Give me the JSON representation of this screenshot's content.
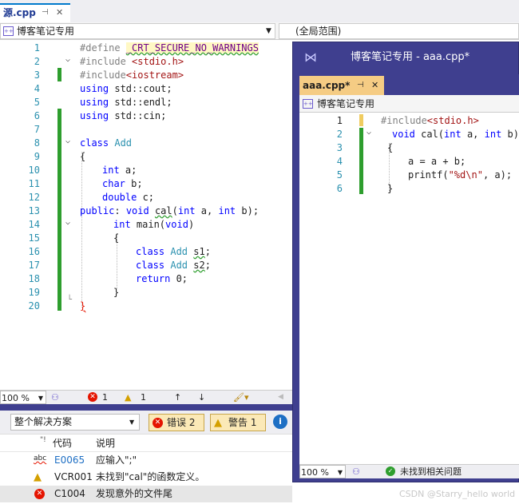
{
  "main_editor": {
    "tab_label": "源.cpp",
    "tab_pin": "⊣",
    "tab_close": "✕",
    "project_dropdown": "博客笔记专用",
    "scope_dropdown": "(全局范围)",
    "lines": [
      {
        "n": "1",
        "text": "#define _CRT_SECURE_NO_WARNINGS"
      },
      {
        "n": "2",
        "text": "#include <stdio.h>"
      },
      {
        "n": "3",
        "text": "#include<iostream>"
      },
      {
        "n": "4",
        "text": "using std::cout;"
      },
      {
        "n": "5",
        "text": "using std::endl;"
      },
      {
        "n": "6",
        "text": "using std::cin;"
      },
      {
        "n": "7",
        "text": ""
      },
      {
        "n": "8",
        "text": "class Add"
      },
      {
        "n": "9",
        "text": "{"
      },
      {
        "n": "10",
        "text": "int a;"
      },
      {
        "n": "11",
        "text": "char b;"
      },
      {
        "n": "12",
        "text": "double c;"
      },
      {
        "n": "13",
        "text": "public:  void cal(int a, int b);"
      },
      {
        "n": "14",
        "text": "int main(void)"
      },
      {
        "n": "15",
        "text": "{"
      },
      {
        "n": "16",
        "text": "class Add s1;"
      },
      {
        "n": "17",
        "text": "class Add s2;"
      },
      {
        "n": "18",
        "text": "return 0;"
      },
      {
        "n": "19",
        "text": "}"
      },
      {
        "n": "20",
        "text": "}"
      }
    ],
    "status": {
      "zoom": "100 %",
      "errors": "1",
      "warnings": "1",
      "up": "↑",
      "down": "↓"
    }
  },
  "floating_window": {
    "title": "博客笔记专用 - aaa.cpp*",
    "tab_label": "aaa.cpp*",
    "tab_pin": "⊣",
    "tab_close": "✕",
    "project_dropdown": "博客笔记专用",
    "lines": [
      {
        "n": "1",
        "text": "#include<stdio.h>"
      },
      {
        "n": "2",
        "text": "void cal(int a, int b)"
      },
      {
        "n": "3",
        "text": "{"
      },
      {
        "n": "4",
        "text": "a = a + b;"
      },
      {
        "n": "5",
        "text": "printf(\"%d\\n\", a);"
      },
      {
        "n": "6",
        "text": "}"
      }
    ],
    "status": {
      "zoom": "100 %",
      "message": "未找到相关问题"
    }
  },
  "error_list": {
    "scope": "整个解决方案",
    "errors_btn": "错误 2",
    "warnings_btn": "警告 1",
    "columns": [
      "代码",
      "说明"
    ],
    "rows": [
      {
        "code": "E0065",
        "desc": "应输入\";\"",
        "kind": "abc"
      },
      {
        "code": "VCR001",
        "desc": "未找到\"cal\"的函数定义。",
        "kind": "warning"
      },
      {
        "code": "C1004",
        "desc": "发现意外的文件尾",
        "kind": "error"
      }
    ]
  },
  "watermark": "CSDN @Starry_hello world",
  "colors": {
    "accent": "#007acc",
    "window_title": "#3f3f8f",
    "change_bar": "#2e9e2e",
    "error": "#e51400",
    "warning": "#f0b400"
  }
}
